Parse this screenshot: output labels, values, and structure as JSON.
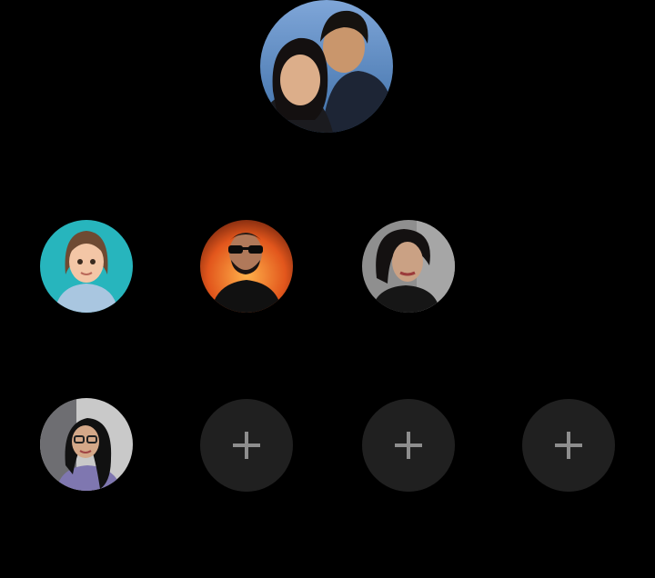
{
  "profiles": {
    "featured": {
      "icon": "couple-profile-photo"
    },
    "row_one": [
      {
        "icon": "animated-girl-avatar"
      },
      {
        "icon": "man-sunglasses-fire-photo"
      },
      {
        "icon": "woman-portrait-photo"
      }
    ],
    "row_two": [
      {
        "icon": "woman-glasses-selfie-photo"
      }
    ]
  },
  "add_slots": [
    {
      "icon": "plus-icon"
    },
    {
      "icon": "plus-icon"
    },
    {
      "icon": "plus-icon"
    }
  ],
  "colors": {
    "background": "#000000",
    "add_slot": "#202020",
    "plus": "#8e8e8e"
  }
}
